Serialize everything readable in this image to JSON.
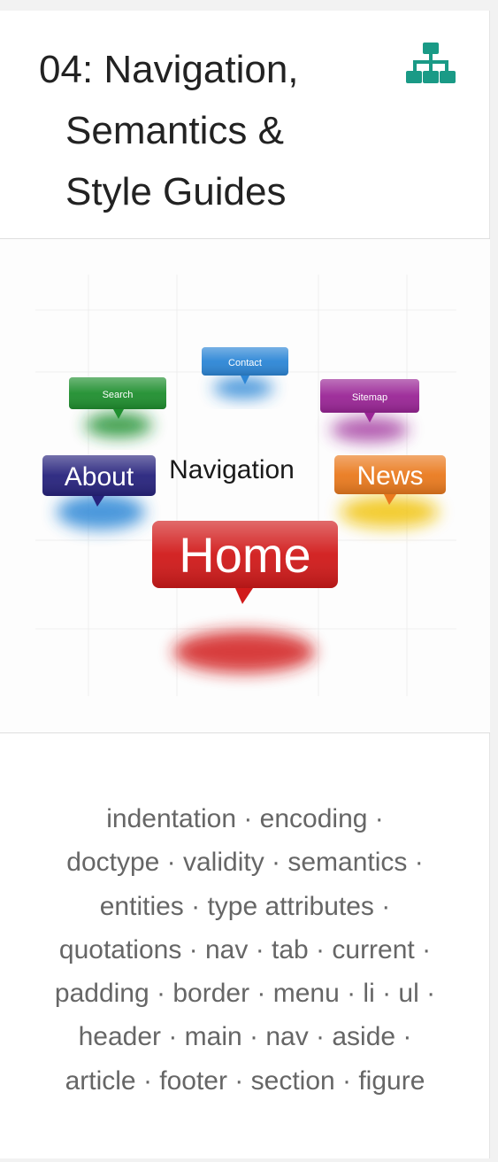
{
  "card": {
    "title_lines": [
      "04: Navigation,",
      "Semantics &",
      "Style Guides"
    ],
    "header_icon": "sitemap-icon",
    "icon_color": "#1a9a86",
    "figure": {
      "word": "Navigation",
      "bubbles": {
        "home": "Home",
        "about": "About",
        "news": "News",
        "search": "Search",
        "contact": "Contact",
        "sitemap": "Sitemap"
      },
      "colors": {
        "home": "#d11a1a",
        "about": "#27237d",
        "news": "#ea7a1e",
        "search": "#1f8f2f",
        "contact": "#2c86d6",
        "sitemap": "#9a2596"
      }
    },
    "tags": [
      "indentation · encoding ·",
      "doctype · validity · semantics ·",
      "entities · type attributes ·",
      "quotations · nav · tab · current ·",
      "padding · border · menu · li · ul ·",
      "header · main · nav · aside ·",
      "article · footer · section · figure"
    ]
  }
}
